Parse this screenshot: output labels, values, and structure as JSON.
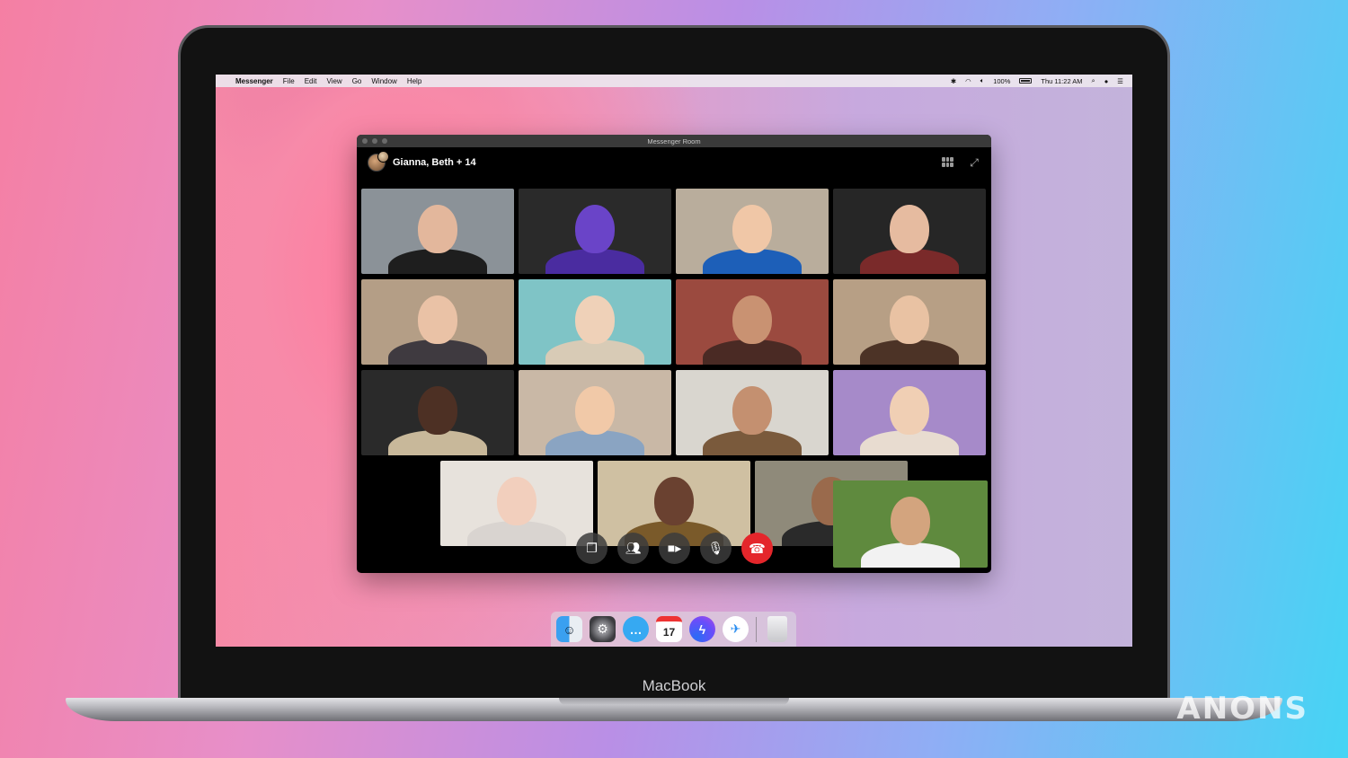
{
  "menubar": {
    "app_name": "Messenger",
    "menus": [
      "File",
      "Edit",
      "View",
      "Go",
      "Window",
      "Help"
    ],
    "battery": "100%",
    "clock": "Thu 11:22 AM"
  },
  "window": {
    "title": "Messenger Room",
    "chat_name": "Gianna, Beth + 14"
  },
  "tiles": [
    {
      "bg": "#8b9298",
      "skin": "#e3b79c",
      "shirt": "#1e1e1e"
    },
    {
      "bg": "#2a2a2a",
      "skin": "#6a44c8",
      "shirt": "#4a2ca0"
    },
    {
      "bg": "#b9ad9c",
      "skin": "#f0c7a7",
      "shirt": "#1d5fb8"
    },
    {
      "bg": "#262626",
      "skin": "#e6bba0",
      "shirt": "#7a2a2a"
    },
    {
      "bg": "#b49e86",
      "skin": "#eac2a6",
      "shirt": "#3f3a40"
    },
    {
      "bg": "#7fc4c6",
      "skin": "#efd1b8",
      "shirt": "#d8cbb6"
    },
    {
      "bg": "#9b4a3f",
      "skin": "#c99272",
      "shirt": "#4a2a24"
    },
    {
      "bg": "#b79f85",
      "skin": "#e9c2a3",
      "shirt": "#4c3326"
    },
    {
      "bg": "#2a2a2a",
      "skin": "#4d3024",
      "shirt": "#c8b89a"
    },
    {
      "bg": "#c9b8a6",
      "skin": "#f1c9a8",
      "shirt": "#8aa4c2"
    },
    {
      "bg": "#d9d6cf",
      "skin": "#c49070",
      "shirt": "#7a5a3c"
    },
    {
      "bg": "#a68ac9",
      "skin": "#f0cfb4",
      "shirt": "#e8dcd0"
    },
    {
      "bg": "#e7e2dc",
      "skin": "#f2cfbd",
      "shirt": "#d9d4d0"
    },
    {
      "bg": "#cfc0a2",
      "skin": "#6a4130",
      "shirt": "#7a5a2a"
    },
    {
      "bg": "#8f8a7a",
      "skin": "#9a6a4c",
      "shirt": "#2a2a2a"
    },
    {
      "bg": "#5f8a3e",
      "skin": "#d3a47e",
      "shirt": "#f2f2f2"
    }
  ],
  "dock": {
    "calendar_day": "17"
  },
  "device_label": "MacBook",
  "watermark": "ANONS",
  "colors": {
    "end_call": "#e4262b",
    "messenger_blue": "#1877f2"
  }
}
